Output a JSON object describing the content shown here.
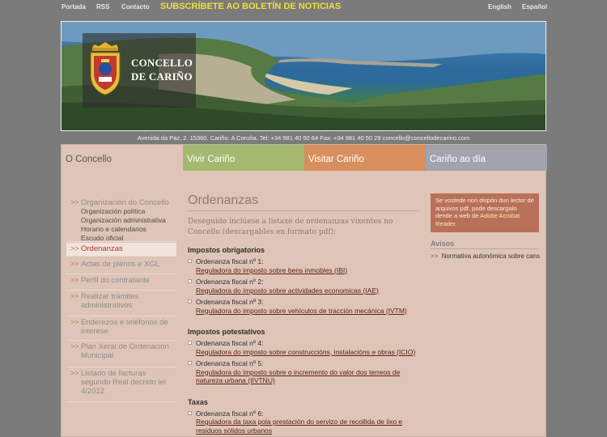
{
  "topnav": {
    "portada": "Portada",
    "rss": "RSS",
    "contacto": "Contacto",
    "newsletter": "SUBSCRÍBETE AO BOLETÍN DE NOTICIAS",
    "english": "English",
    "espanol": "Español"
  },
  "logo": {
    "line1": "CONCELLO",
    "line2": "DE CARIÑO"
  },
  "address": "Avenida da Paz, 2. 15360. Cariño. A Coruña. Tel: +34 981 40 50 64 Fax: +34 981 40 50 29 concello@concellodecarino.com",
  "tabs": [
    "O Concello",
    "Vivir Cariño",
    "Visitar Cariño",
    "Cariño ao día"
  ],
  "menu": {
    "organizacion": "Organización do Concello",
    "sub": [
      "Organización política",
      "Organización administrativa",
      "Horario e calendarios",
      "Escudo oficial"
    ],
    "ordenanzas": "Ordenanzas",
    "actas": "Actas de plenos e XGL",
    "perfil": "Perfil do contratante",
    "tramites": "Realizar trámites administrativos",
    "enderezos": "Enderezos e teléfonos de interese",
    "plan": "Plan Xeral de Ordenación Municipal",
    "facturas": "Listado de facturas segundo Real decreto lei 4/2012"
  },
  "content": {
    "title": "Ordenanzas",
    "intro": "Deseguido inclúese a listaxe de ordenanzas vixentes no Concello (descargables en formato pdf):",
    "sections": [
      {
        "heading": "Impostos obrigatorios",
        "items": [
          {
            "label": "Ordenanza fiscal nº 1:",
            "link": "Reguladora do imposto sobre bens inmobles (IBI)"
          },
          {
            "label": "Ordenanza fiscal nº 2:",
            "link": "Reguladora do imposto sobre actividades economicas (IAE)"
          },
          {
            "label": "Ordenanza fiscal nº 3:",
            "link": "Reguladora do imposto sobre vehículos de tracción mecánica (IVTM)"
          }
        ]
      },
      {
        "heading": "Impostos potestativos",
        "items": [
          {
            "label": "Ordenanza fiscal nº 4:",
            "link": "Reguladora do imposto sobre construccións, instalacións e obras (ICIO)"
          },
          {
            "label": "Ordenanza fiscal nº 5:",
            "link": "Reguladora do imposto sobre o incremento do valor dos terreos de natureza urbana (IIVTNU)"
          }
        ]
      },
      {
        "heading": "Taxas",
        "items": [
          {
            "label": "Ordenanza fiscal nº 6:",
            "link": "Reguladora da taxa pola prestación do servizo de recollida de lixo e residuos sólidos urbanos"
          }
        ]
      }
    ]
  },
  "sidebar": {
    "notice_text": "Se vostede non dispón dun lector de arquivos pdf, pode descargalo dende a web de ",
    "notice_link": "Adobe Acrobat Reader.",
    "avisos_title": "Avisos",
    "avisos_item": "Normativa autonómica sobre cans"
  },
  "colors": {
    "background": "#7b7b7b",
    "panel": "#dfc5b7",
    "tab_vivir": "#a4b96f",
    "tab_visitar": "#d78f5d",
    "tab_dia": "#a3a3ad",
    "newsletter": "#f2df3a",
    "notice": "#b87158"
  }
}
